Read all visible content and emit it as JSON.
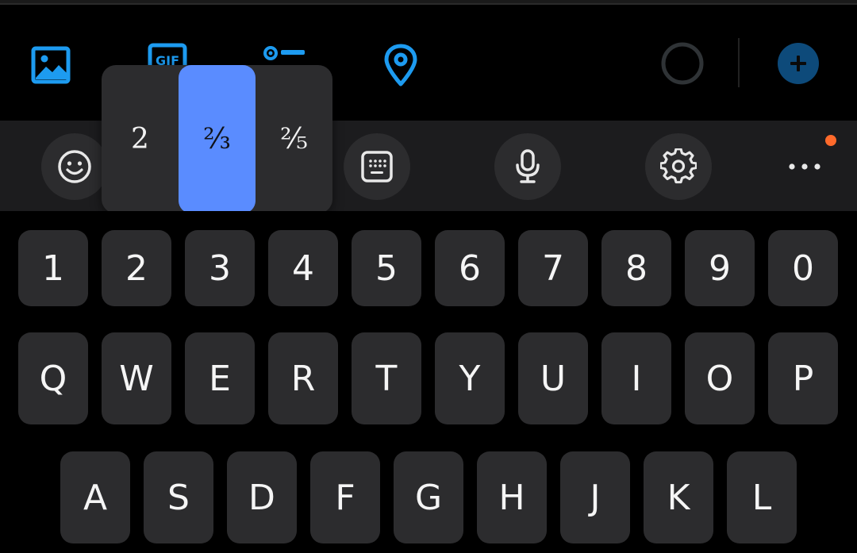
{
  "compose": {
    "icons": [
      {
        "name": "image-icon"
      },
      {
        "name": "gif-icon",
        "label": "GIF"
      },
      {
        "name": "poll-icon"
      },
      {
        "name": "location-icon"
      },
      {
        "name": "character-count-ring-icon"
      },
      {
        "name": "add-thread-icon"
      }
    ],
    "accent": "#1d9bf0"
  },
  "toolbar": {
    "buttons": [
      "emoji-icon",
      "numpad-icon",
      "microphone-icon",
      "settings-icon",
      "more-icon"
    ],
    "notification_color": "#ff6a2b"
  },
  "popup": {
    "options": [
      "2",
      "²⁄₃",
      "²⁄₅"
    ],
    "selected_index": 1,
    "selected_color": "#5a8cff"
  },
  "keyboard": {
    "number_row": [
      "1",
      "2",
      "3",
      "4",
      "5",
      "6",
      "7",
      "8",
      "9",
      "0"
    ],
    "row1": [
      "Q",
      "W",
      "E",
      "R",
      "T",
      "Y",
      "U",
      "I",
      "O",
      "P"
    ],
    "row2": [
      "A",
      "S",
      "D",
      "F",
      "G",
      "H",
      "J",
      "K",
      "L"
    ]
  }
}
